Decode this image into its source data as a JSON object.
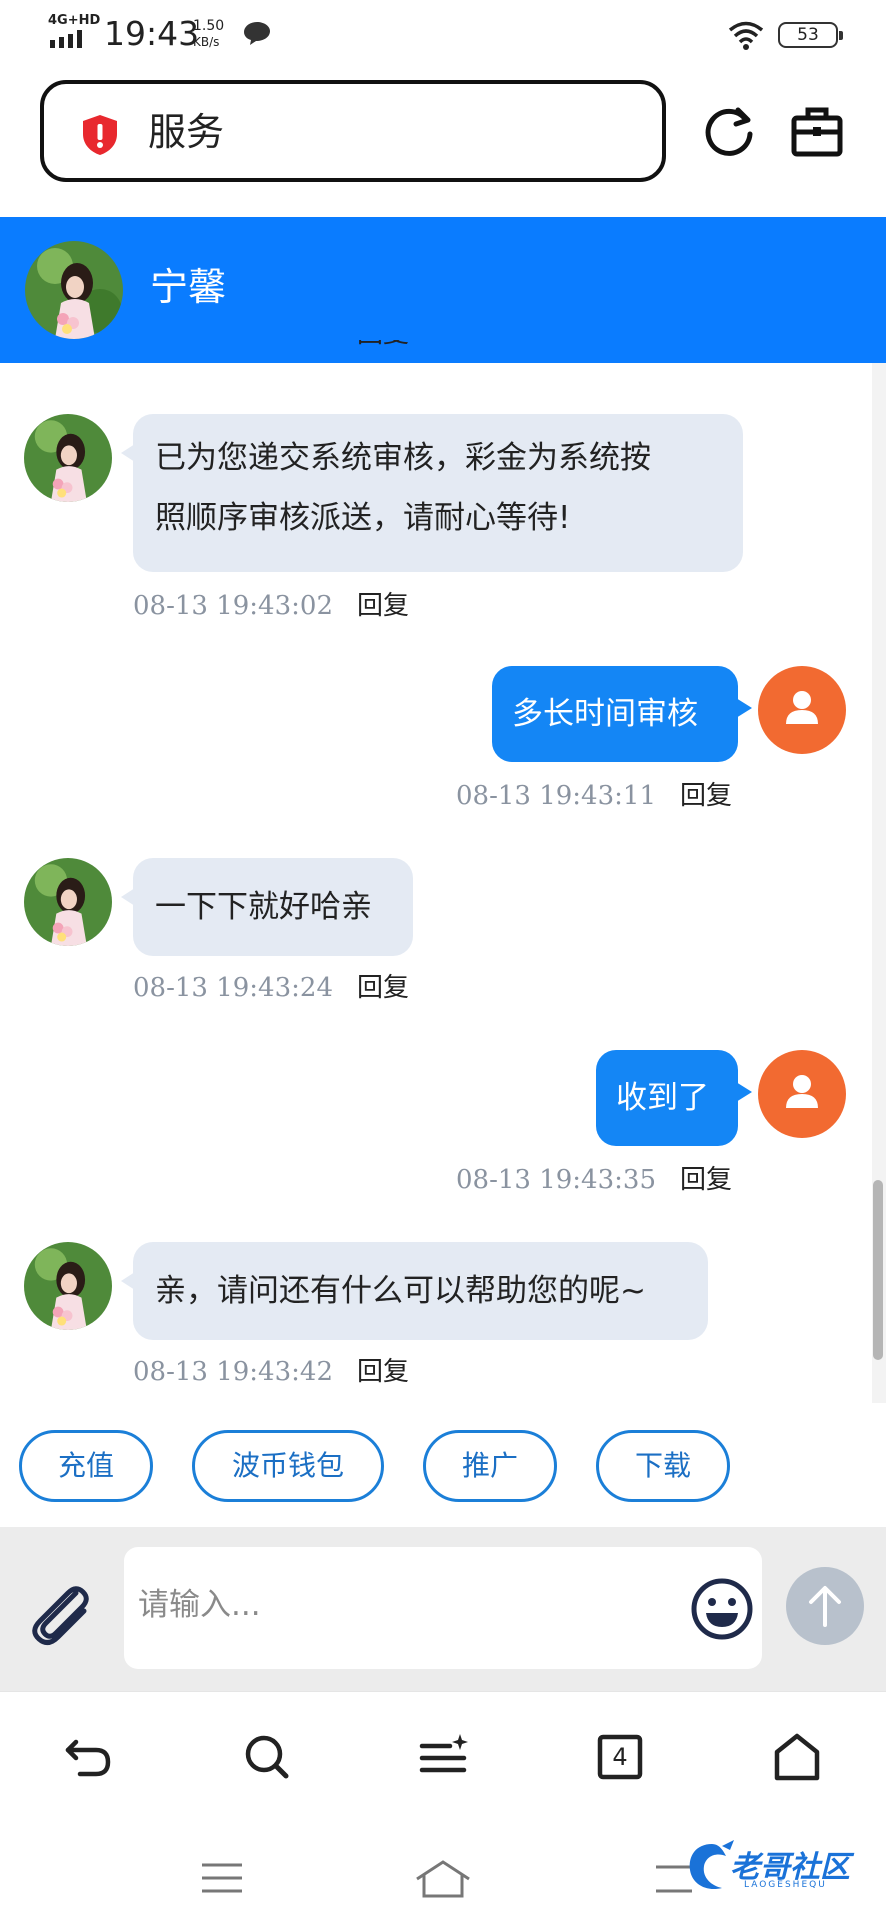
{
  "status_bar": {
    "network": "4G+HD",
    "time": "19:43",
    "speed_value": "1.50",
    "speed_unit": "KB/s",
    "battery": "53"
  },
  "browser": {
    "url_text": "服务",
    "icons": [
      "shield-alert-icon",
      "reload-icon",
      "wallet-icon"
    ]
  },
  "chat": {
    "agent_name": "宁馨",
    "partial_top_reply": "回复",
    "messages": [
      {
        "side": "in",
        "lines": [
          "已为您递交系统审核，彩金为系统按",
          "照顺序审核派送，请耐心等待!"
        ],
        "time": "08-13 19:43:02",
        "reply": "回复"
      },
      {
        "side": "out",
        "text": "多长时间审核",
        "time": "08-13 19:43:11",
        "reply": "回复"
      },
      {
        "side": "in",
        "text": "一下下就好哈亲",
        "time": "08-13 19:43:24",
        "reply": "回复"
      },
      {
        "side": "out",
        "text": "收到了",
        "time": "08-13 19:43:35",
        "reply": "回复"
      },
      {
        "side": "in",
        "text": "亲，请问还有什么可以帮助您的呢~",
        "time": "08-13 19:43:42",
        "reply": "回复"
      }
    ]
  },
  "quick_actions": [
    "充值",
    "波币钱包",
    "推广",
    "下载"
  ],
  "composer": {
    "placeholder": "请输入..."
  },
  "browser_nav": {
    "tab_count": "4",
    "icons": [
      "back-icon",
      "search-icon",
      "menu-plus-icon",
      "tabs-icon",
      "home-icon"
    ]
  },
  "watermark": {
    "text": "老哥社区",
    "sub": "LAOGESHEQU"
  },
  "colors": {
    "header_blue": "#0a7cff",
    "user_bubble": "#1486f5",
    "agent_bubble": "#e4eaf3",
    "user_avatar": "#f26a31",
    "quick_border": "#1b7fd8"
  }
}
